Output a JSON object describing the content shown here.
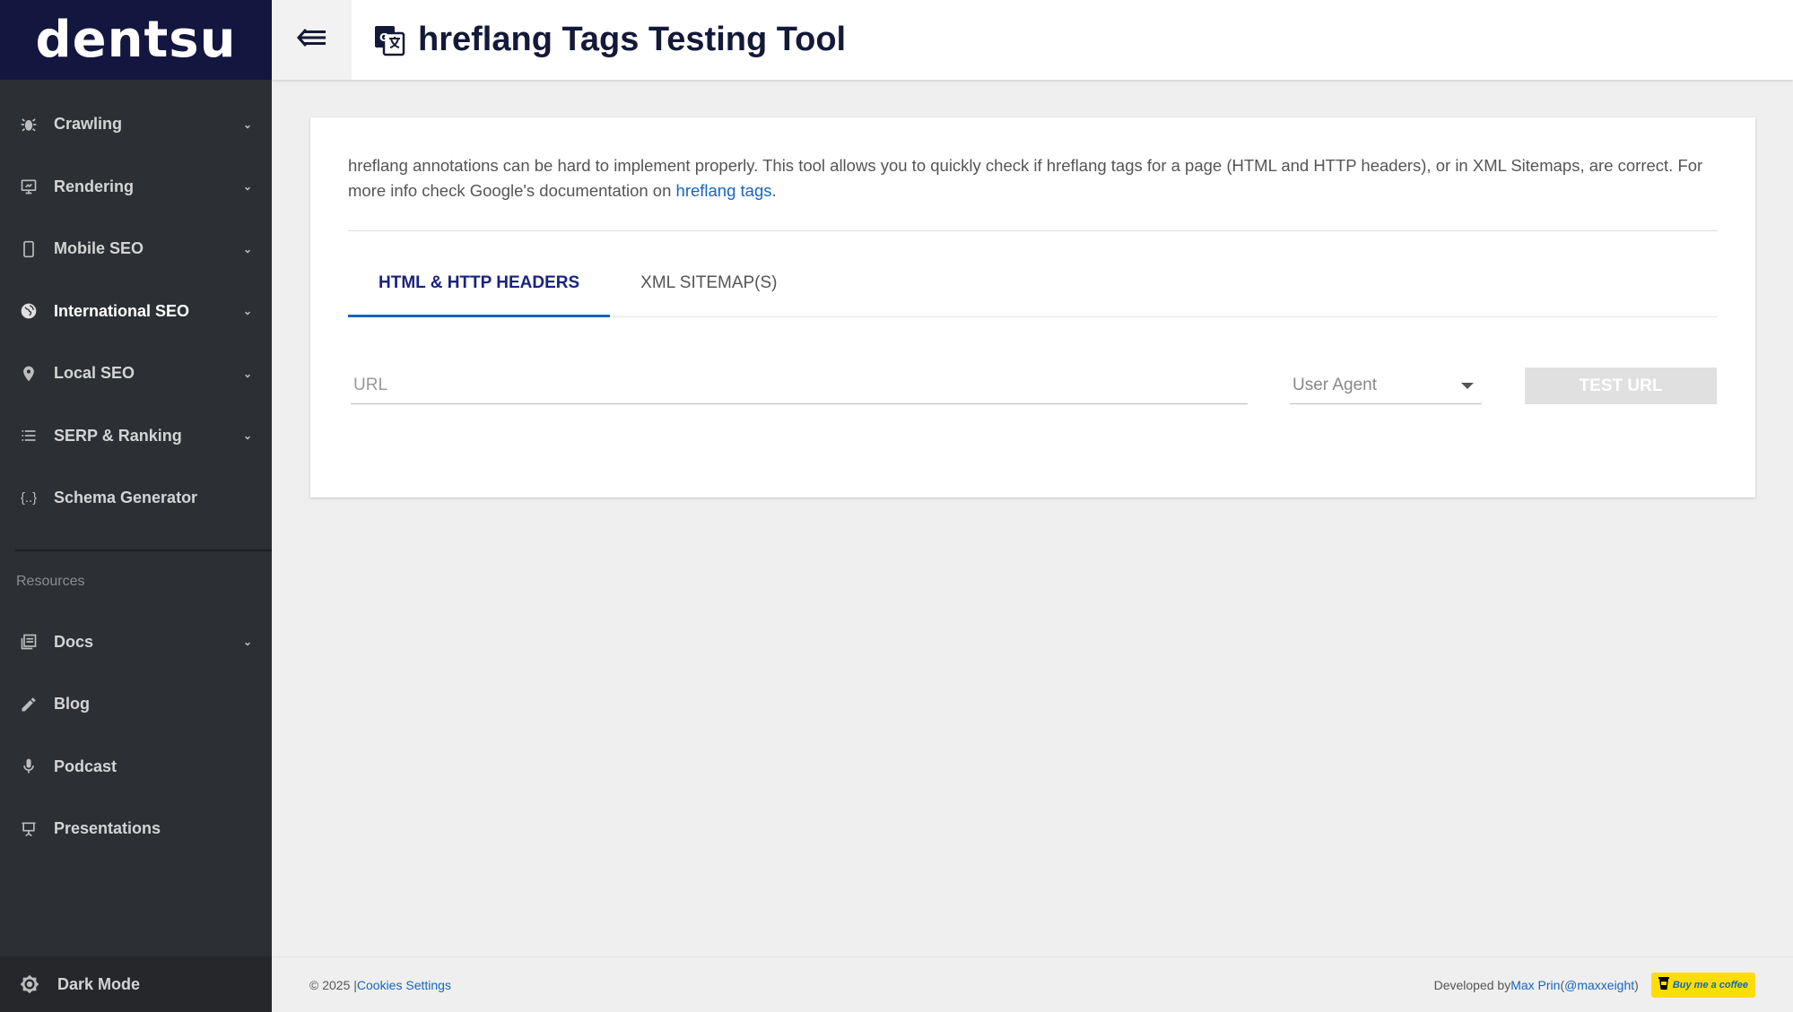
{
  "brand": {
    "logo_text": "dentsu"
  },
  "header": {
    "title": "hreflang Tags Testing Tool",
    "title_icon": "translate-icon",
    "menu_toggle_icon": "collapse-menu-icon"
  },
  "sidebar": {
    "items": [
      {
        "label": "Crawling",
        "icon": "bug-icon",
        "has_chevron": true
      },
      {
        "label": "Rendering",
        "icon": "monitor-icon",
        "has_chevron": true
      },
      {
        "label": "Mobile SEO",
        "icon": "phone-icon",
        "has_chevron": true
      },
      {
        "label": "International SEO",
        "icon": "globe-icon",
        "has_chevron": true,
        "active": true
      },
      {
        "label": "Local SEO",
        "icon": "map-pin-icon",
        "has_chevron": true
      },
      {
        "label": "SERP & Ranking",
        "icon": "list-icon",
        "has_chevron": true
      },
      {
        "label": "Schema Generator",
        "icon": "braces-icon",
        "has_chevron": false
      }
    ],
    "resources_label": "Resources",
    "resources": [
      {
        "label": "Docs",
        "icon": "docs-icon",
        "has_chevron": true
      },
      {
        "label": "Blog",
        "icon": "pencil-icon",
        "has_chevron": false
      },
      {
        "label": "Podcast",
        "icon": "microphone-icon",
        "has_chevron": false
      },
      {
        "label": "Presentations",
        "icon": "presentation-icon",
        "has_chevron": false
      }
    ],
    "dark_mode_label": "Dark Mode"
  },
  "main": {
    "description_text": "hreflang annotations can be hard to implement properly. This tool allows you to quickly check if hreflang tags for a page (HTML and HTTP headers), or in XML Sitemaps, are correct. For more info check Google's documentation on ",
    "description_link": "hreflang tags",
    "description_end": ".",
    "tabs": [
      {
        "label": "HTML & HTTP HEADERS",
        "active": true
      },
      {
        "label": "XML SITEMAP(S)",
        "active": false
      }
    ],
    "url_placeholder": "URL",
    "user_agent_placeholder": "User Agent",
    "test_button_label": "TEST URL"
  },
  "footer": {
    "copyright": "© 2025 | ",
    "cookies_link": "Cookies Settings",
    "developed_by": "Developed by ",
    "author_link": "Max Prin",
    "handle_open": " (",
    "handle_link": "@maxxeight",
    "handle_close": ")",
    "coffee_label": "Buy me a coffee"
  },
  "colors": {
    "sidebar_bg": "#2c2f33",
    "brand_bg": "#13173f",
    "accent": "#1565c0",
    "active_tab_text": "#1a237e",
    "coffee_yellow": "#ffdd00"
  }
}
